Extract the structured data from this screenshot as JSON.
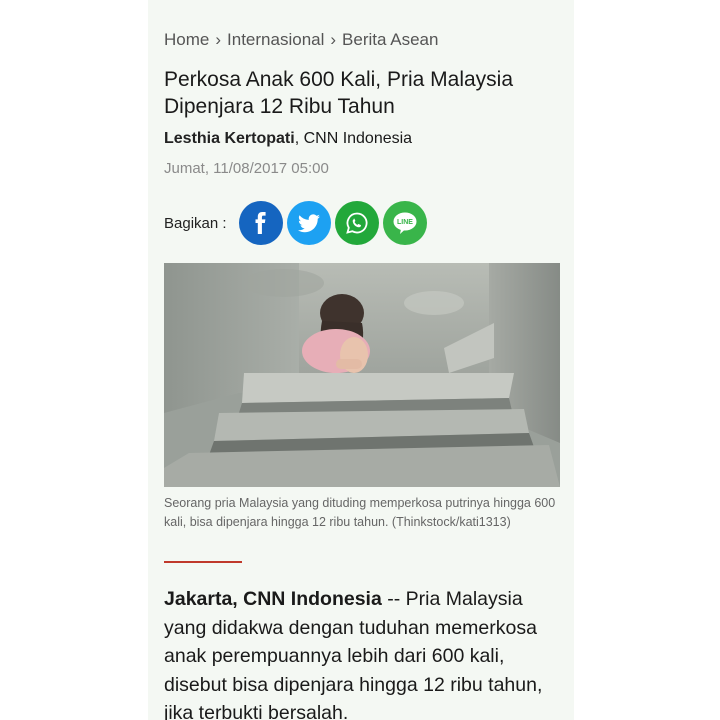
{
  "breadcrumb": {
    "items": [
      "Home",
      "Internasional",
      "Berita Asean"
    ],
    "separator": "›"
  },
  "article": {
    "title": "Perkosa Anak 600 Kali, Pria Malaysia Dipenjara 12 Ribu Tahun",
    "author": "Lesthia Kertopati",
    "source": ", CNN Indonesia",
    "date": "Jumat, 11/08/2017 05:00",
    "share_label": "Bagikan :",
    "share_buttons": [
      {
        "name": "facebook",
        "icon": "facebook-icon",
        "color": "#1565c0"
      },
      {
        "name": "twitter",
        "icon": "twitter-icon",
        "color": "#1da1f2"
      },
      {
        "name": "whatsapp",
        "icon": "whatsapp-icon",
        "color": "#22a83a"
      },
      {
        "name": "line",
        "icon": "line-icon",
        "color": "#39b54a",
        "label": "LINE"
      }
    ],
    "image_caption": "Seorang pria Malaysia yang dituding memperkosa putrinya hingga 600 kali, bisa dipenjara hingga 12 ribu tahun. (Thinkstock/kati1313)",
    "lead_dateline": "Jakarta, CNN Indonesia",
    "lead_text": " -- Pria Malaysia yang didakwa dengan tuduhan memerkosa anak perempuannya lebih dari 600 kali, disebut bisa dipenjara hingga 12 ribu tahun, jika terbukti bersalah."
  },
  "colors": {
    "page_bg": "#f4f8f3",
    "caption_divider": "#c0392b"
  }
}
